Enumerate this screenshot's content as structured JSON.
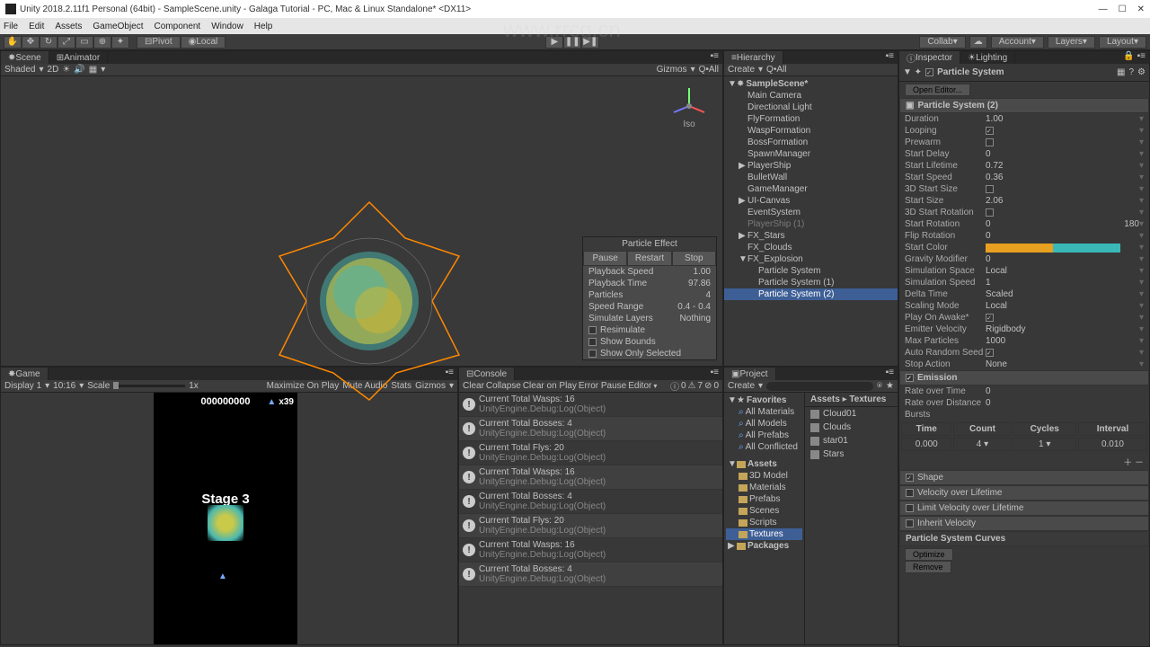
{
  "window": {
    "title": "Unity 2018.2.11f1 Personal (64bit) - SampleScene.unity - Galaga Tutorial - PC, Mac & Linux Standalone* <DX11>"
  },
  "menu": [
    "File",
    "Edit",
    "Assets",
    "GameObject",
    "Component",
    "Window",
    "Help"
  ],
  "toolbar": {
    "pivot": "Pivot",
    "local": "Local",
    "collab": "Collab",
    "account": "Account",
    "layers": "Layers",
    "layout": "Layout"
  },
  "scene": {
    "tab_scene": "Scene",
    "tab_animator": "Animator",
    "shaded": "Shaded",
    "d2": "2D",
    "gizmos": "Gizmos",
    "q_all": "Q•All",
    "iso": "Iso"
  },
  "particle_effect": {
    "title": "Particle Effect",
    "pause": "Pause",
    "restart": "Restart",
    "stop": "Stop",
    "rows": [
      {
        "k": "Playback Speed",
        "v": "1.00"
      },
      {
        "k": "Playback Time",
        "v": "97.86"
      },
      {
        "k": "Particles",
        "v": "4"
      },
      {
        "k": "Speed Range",
        "v": "0.4 - 0.4"
      },
      {
        "k": "Simulate Layers",
        "v": "Nothing"
      }
    ],
    "resim": "Resimulate",
    "bounds": "Show Bounds",
    "only": "Show Only Selected"
  },
  "game": {
    "tab": "Game",
    "display": "Display 1",
    "res": "10:16",
    "scale": "Scale",
    "max": "Maximize On Play",
    "mute": "Mute Audio",
    "stats": "Stats",
    "gizmos": "Gizmos",
    "score": "000000000",
    "lives": "x39",
    "stage": "Stage 3"
  },
  "console": {
    "tab": "Console",
    "btns": [
      "Clear",
      "Collapse",
      "Clear on Play",
      "Error Pause",
      "Editor"
    ],
    "count0": "0",
    "count7": "7",
    "count00": "0",
    "entries": [
      {
        "l1": "Current Total Wasps: 16",
        "l2": "UnityEngine.Debug:Log(Object)"
      },
      {
        "l1": "Current Total Bosses: 4",
        "l2": "UnityEngine.Debug:Log(Object)"
      },
      {
        "l1": "Current Total Flys: 20",
        "l2": "UnityEngine.Debug:Log(Object)"
      },
      {
        "l1": "Current Total Wasps: 16",
        "l2": "UnityEngine.Debug:Log(Object)"
      },
      {
        "l1": "Current Total Bosses: 4",
        "l2": "UnityEngine.Debug:Log(Object)"
      },
      {
        "l1": "Current Total Flys: 20",
        "l2": "UnityEngine.Debug:Log(Object)"
      },
      {
        "l1": "Current Total Wasps: 16",
        "l2": "UnityEngine.Debug:Log(Object)"
      },
      {
        "l1": "Current Total Bosses: 4",
        "l2": "UnityEngine.Debug:Log(Object)"
      }
    ]
  },
  "hierarchy": {
    "tab": "Hierarchy",
    "create": "Create",
    "q_all": "Q•All",
    "scene_name": "SampleScene*",
    "items": [
      {
        "name": "Main Camera",
        "indent": 1
      },
      {
        "name": "Directional Light",
        "indent": 1
      },
      {
        "name": "FlyFormation",
        "indent": 1
      },
      {
        "name": "WaspFormation",
        "indent": 1
      },
      {
        "name": "BossFormation",
        "indent": 1
      },
      {
        "name": "SpawnManager",
        "indent": 1
      },
      {
        "name": "PlayerShip",
        "indent": 1,
        "fold": true
      },
      {
        "name": "BulletWall",
        "indent": 1
      },
      {
        "name": "GameManager",
        "indent": 1
      },
      {
        "name": "UI-Canvas",
        "indent": 1,
        "fold": true
      },
      {
        "name": "EventSystem",
        "indent": 1
      },
      {
        "name": "PlayerShip (1)",
        "indent": 1,
        "inactive": true
      },
      {
        "name": "FX_Stars",
        "indent": 1,
        "fold": true
      },
      {
        "name": "FX_Clouds",
        "indent": 1
      },
      {
        "name": "FX_Explosion",
        "indent": 1,
        "fold": true,
        "open": true
      },
      {
        "name": "Particle System",
        "indent": 2
      },
      {
        "name": "Particle System (1)",
        "indent": 2
      },
      {
        "name": "Particle System (2)",
        "indent": 2,
        "selected": true
      }
    ]
  },
  "project": {
    "tab": "Project",
    "create": "Create",
    "favorites": "Favorites",
    "fav_items": [
      "All Materials",
      "All Models",
      "All Prefabs",
      "All Conflicted"
    ],
    "assets": "Assets",
    "asset_folders": [
      "3D Model",
      "Materials",
      "Prefabs",
      "Scenes",
      "Scripts",
      "Textures"
    ],
    "packages": "Packages",
    "breadcrumb_assets": "Assets",
    "breadcrumb_textures": "Textures",
    "files": [
      "Cloud01",
      "Clouds",
      "star01",
      "Stars"
    ]
  },
  "inspector": {
    "tab_inspector": "Inspector",
    "tab_lighting": "Lighting",
    "name": "Particle System",
    "open_editor": "Open Editor...",
    "module_main": "Particle System (2)",
    "props": [
      {
        "k": "Duration",
        "v": "1.00"
      },
      {
        "k": "Looping",
        "check": true
      },
      {
        "k": "Prewarm",
        "check": false
      },
      {
        "k": "Start Delay",
        "v": "0"
      },
      {
        "k": "Start Lifetime",
        "v": "0.72"
      },
      {
        "k": "Start Speed",
        "v": "0.36"
      },
      {
        "k": "3D Start Size",
        "check": false
      },
      {
        "k": "Start Size",
        "v": "2.06"
      },
      {
        "k": "3D Start Rotation",
        "check": false
      },
      {
        "k": "Start Rotation",
        "v": "0",
        "v2": "180"
      },
      {
        "k": "Flip Rotation",
        "v": "0"
      },
      {
        "k": "Start Color",
        "color": true
      },
      {
        "k": "Gravity Modifier",
        "v": "0"
      },
      {
        "k": "Simulation Space",
        "v": "Local"
      },
      {
        "k": "Simulation Speed",
        "v": "1"
      },
      {
        "k": "Delta Time",
        "v": "Scaled"
      },
      {
        "k": "Scaling Mode",
        "v": "Local"
      },
      {
        "k": "Play On Awake*",
        "check": true
      },
      {
        "k": "Emitter Velocity",
        "v": "Rigidbody"
      },
      {
        "k": "Max Particles",
        "v": "1000"
      },
      {
        "k": "Auto Random Seed",
        "check": true
      },
      {
        "k": "Stop Action",
        "v": "None"
      }
    ],
    "emission": "Emission",
    "rate_time": "Rate over Time",
    "rate_time_v": "0",
    "rate_dist": "Rate over Distance",
    "rate_dist_v": "0",
    "bursts": "Bursts",
    "burst_cols": [
      "Time",
      "Count",
      "Cycles",
      "Interval"
    ],
    "burst_row": [
      "0.000",
      "4",
      "1",
      "0.010"
    ],
    "modules": [
      "Shape",
      "Velocity over Lifetime",
      "Limit Velocity over Lifetime",
      "Inherit Velocity"
    ],
    "curves": "Particle System Curves",
    "optimize": "Optimize",
    "remove": "Remove"
  },
  "watermark": "www.rrcg.cn"
}
